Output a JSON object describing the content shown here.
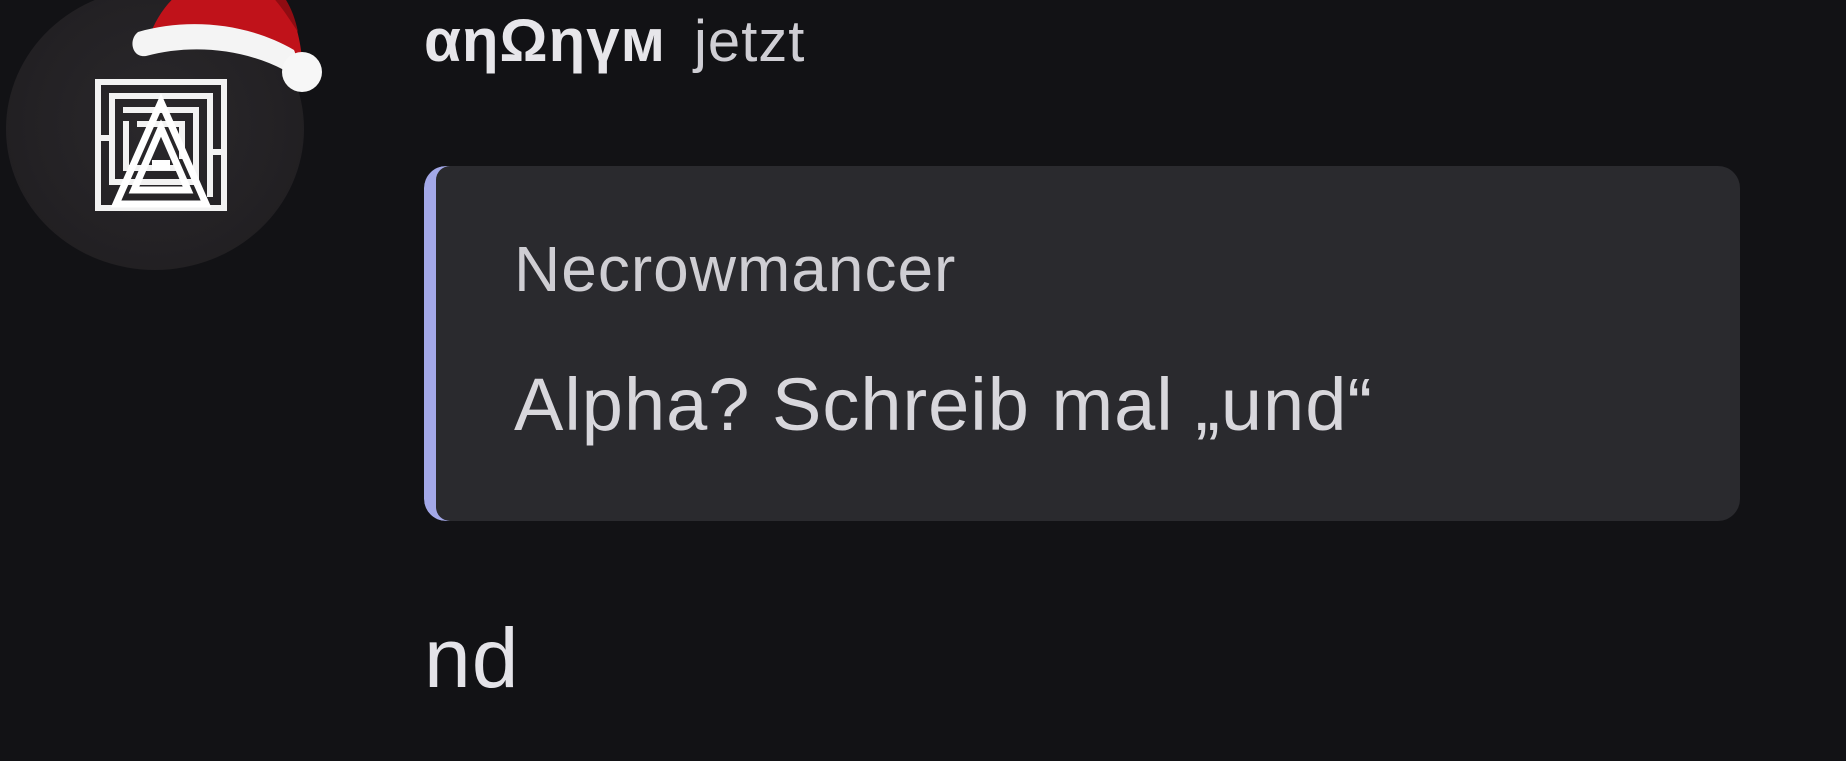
{
  "message": {
    "author": "αηΩηүм",
    "timestamp": "jetzt",
    "body": "nd",
    "reply": {
      "author": "Necrowmancer",
      "text": "Alpha? Schreib mal „und“"
    }
  },
  "avatar": {
    "decoration": "santa-hat-icon",
    "logo": "maze-triangle-icon"
  },
  "colors": {
    "background": "#121215",
    "reply_background": "#2a2a2e",
    "reply_accent": "#a3a8e8",
    "hat_red": "#c0121a",
    "text_primary": "#e7e6ea"
  }
}
